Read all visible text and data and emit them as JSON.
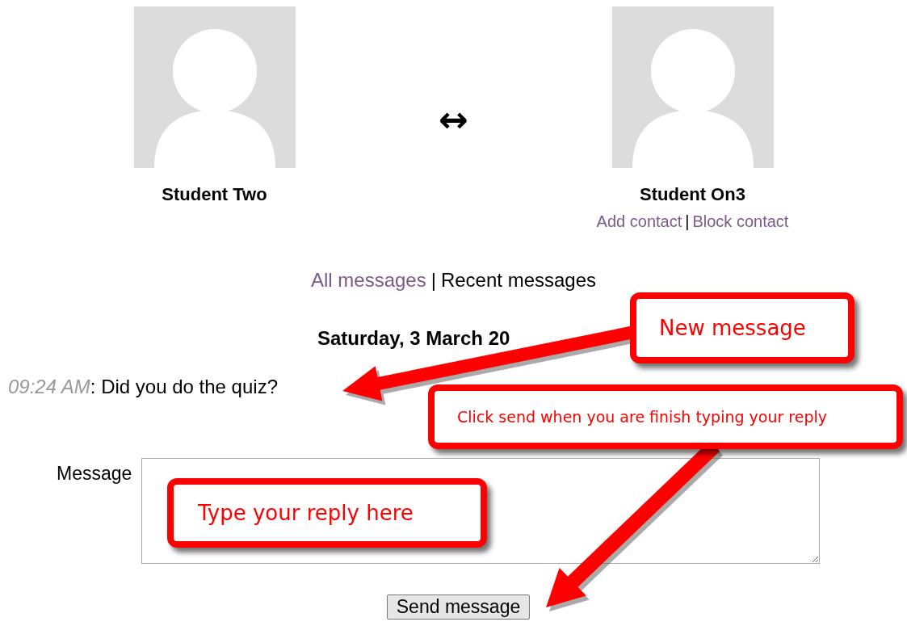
{
  "profiles": [
    {
      "name": "Student Two"
    },
    {
      "name": "Student On3",
      "links": [
        "Add contact",
        "Block contact"
      ]
    }
  ],
  "swap_icon": "↔",
  "separator": "|",
  "view_links": [
    {
      "label": "All messages",
      "selected": false
    },
    {
      "label": "Recent messages",
      "selected": true
    }
  ],
  "date": "Saturday, 3 March 20",
  "messages": [
    {
      "time": "09:24 AM",
      "text": ": Did you do the quiz?"
    }
  ],
  "form": {
    "label": "Message",
    "button": "Send message"
  },
  "callouts": [
    {
      "text": "New message"
    },
    {
      "text": "Click send when you are finish typing your reply"
    },
    {
      "text": "Type your reply here"
    }
  ]
}
